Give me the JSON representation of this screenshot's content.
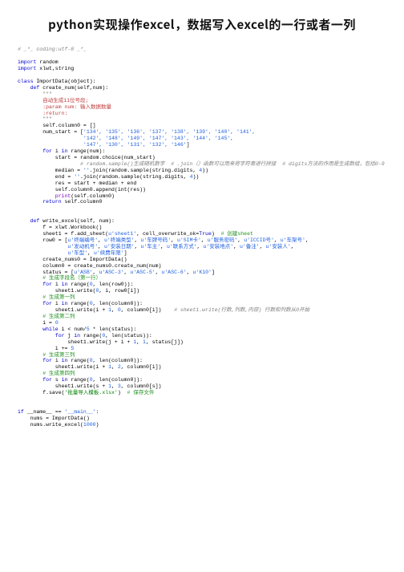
{
  "title": "python实现操作excel，数据写入excel的一行或者一列",
  "code": {
    "l1": "# _*_ coding:utf-8 _*_",
    "l2a": "import",
    "l2b": " random",
    "l3a": "import",
    "l3b": " xlwt,string",
    "l4a": "class ",
    "l4b": "ImportData(object):",
    "l5a": "    def ",
    "l5b": "create_num(self,num):",
    "l6": "        \"\"\"",
    "l7": "        自动生成11位号段;",
    "l8": "        :param num: 输入数据数量",
    "l9": "        :return:",
    "l10": "        \"\"\"",
    "l11": "        self.column0 = []",
    "l12a": "        num_start = [",
    "l12b": "'134', '135', '136', '137', '138', '139', '140', '141',",
    "l13": "                     '142', '148', '149', '147', '143', '144', '145',",
    "l14a": "                     '147', '130', '131', '132', '146'",
    "l14b": "]",
    "l15a": "        for ",
    "l15b": "i ",
    "l15c": "in ",
    "l15d": "range(num):",
    "l16": "            start = random.choice(num_start)",
    "l17": "                    # random.sample()生成随机数字  # .join（）函数可以用来将字符串进行拼接  # digits方法的作用是生成数组，包括0-9",
    "l18a": "            median = ",
    "l18b": "''",
    "l18c": ".join(random.sample(string.digits, ",
    "l18d": "4",
    "l18e": "))",
    "l19a": "            end = ",
    "l19b": "''",
    "l19c": ".join(random.sample(string.digits, ",
    "l19d": "4",
    "l19e": "))",
    "l20": "            res = start + median + end",
    "l21": "            self.column0.append(int(res))",
    "l22a": "            print",
    "l22b": "(self.column0)",
    "l23a": "        return ",
    "l23b": "self.column0",
    "l24a": "    def ",
    "l24b": "write_excel(self, num):",
    "l25": "        f = xlwt.Workbook()",
    "l26a": "        sheet1 = f.add_sheet(",
    "l26b": "u'sheet1'",
    "l26c": ", cell_overwrite_ok=",
    "l26d": "True",
    "l26e": ")  ",
    "l26f": "# 创建sheet",
    "l27a": "        row0 = [",
    "l27b": "u'终端编号'",
    "l27c": ", ",
    "l27d": "u'终端类型'",
    "l27e": ", ",
    "l27f": "u'车牌号码'",
    "l27g": ", ",
    "l27h": "u'SIM卡'",
    "l27i": ", ",
    "l27j": "u'服务密码'",
    "l27k": ", ",
    "l27l": "u'ICCID号'",
    "l27m": ", ",
    "l27n": "u'车架号'",
    "l27o": ",",
    "l28a": "                ",
    "l28b": "u'发动机号'",
    "l28c": ", ",
    "l28d": "u'安装日期'",
    "l28e": ", ",
    "l28f": "u'车主'",
    "l28g": ", ",
    "l28h": "u'联系方式'",
    "l28i": ", ",
    "l28j": "u'安装地点'",
    "l28k": ", ",
    "l28l": "u'备注'",
    "l28m": ", ",
    "l28n": "u'安装人'",
    "l28o": ",",
    "l29a": "                ",
    "l29b": "u'车型'",
    "l29c": ", ",
    "l29d": "u'续费年限'",
    "l29e": "]",
    "l30": "        create_nums0 = ImportData()",
    "l31": "        column0 = create_nums0.create_num(num)",
    "l32a": "        status = [",
    "l32b": "u'ASB'",
    "l32c": ", ",
    "l32d": "u'ASC-3'",
    "l32e": ", ",
    "l32f": "u'ASC-5'",
    "l32g": ", ",
    "l32h": "u'ASC-6'",
    "l32i": ", ",
    "l32j": "u'K10'",
    "l32k": "]",
    "l33": "        # 生成字段名（第一行）",
    "l34a": "        for ",
    "l34b": "i ",
    "l34c": "in ",
    "l34d": "range(",
    "l34e": "0",
    "l34f": ", len(row0)):",
    "l35a": "            sheet1.write(",
    "l35b": "0",
    "l35c": ", i, row0[i])",
    "l36": "        # 生成第一列",
    "l37a": "        for ",
    "l37b": "i ",
    "l37c": "in ",
    "l37d": "range(",
    "l37e": "0",
    "l37f": ", len(column0)):",
    "l38a": "            sheet1.write(i + ",
    "l38b": "1",
    "l38c": ", ",
    "l38d": "0",
    "l38e": ", column0[i])    ",
    "l38f": "# sheet1.write(行数,列数,内容) 行数和列数从0开始",
    "l39": "        # 生成第二列",
    "l40a": "        i = ",
    "l40b": "0",
    "l41a": "        while ",
    "l41b": "i < num/",
    "l41c": "5 ",
    "l41d": "* len(status):",
    "l42a": "            for ",
    "l42b": "j ",
    "l42c": "in ",
    "l42d": "range(",
    "l42e": "0",
    "l42f": ", len(status)):",
    "l43a": "                sheet1.write(j + i + ",
    "l43b": "1",
    "l43c": ", ",
    "l43d": "1",
    "l43e": ", status[j])",
    "l44a": "            i += ",
    "l44b": "5",
    "l45": "        # 生成第三列",
    "l46a": "        for ",
    "l46b": "i ",
    "l46c": "in ",
    "l46d": "range(",
    "l46e": "0",
    "l46f": ", len(column0)):",
    "l47a": "            sheet1.write(i + ",
    "l47b": "1",
    "l47c": ", ",
    "l47d": "2",
    "l47e": ", column0[i])",
    "l48": "        # 生成第四列",
    "l49a": "        for ",
    "l49b": "s ",
    "l49c": "in ",
    "l49d": "range(",
    "l49e": "0",
    "l49f": ", len(column0)):",
    "l50a": "            sheet1.write(s + ",
    "l50b": "1",
    "l50c": ", ",
    "l50d": "3",
    "l50e": ", column0[s])",
    "l51a": "        f.save(",
    "l51b": "'批量导入模板.xlsx'",
    "l51c": ")  ",
    "l51d": "# 保存文件",
    "l52a": "if ",
    "l52b": "__name__",
    "l52c": " == ",
    "l52d": "'__main__'",
    "l52e": ":",
    "l53": "    nums = ImportData()",
    "l54a": "    nums.write_excel(",
    "l54b": "1000",
    "l54c": ")"
  }
}
